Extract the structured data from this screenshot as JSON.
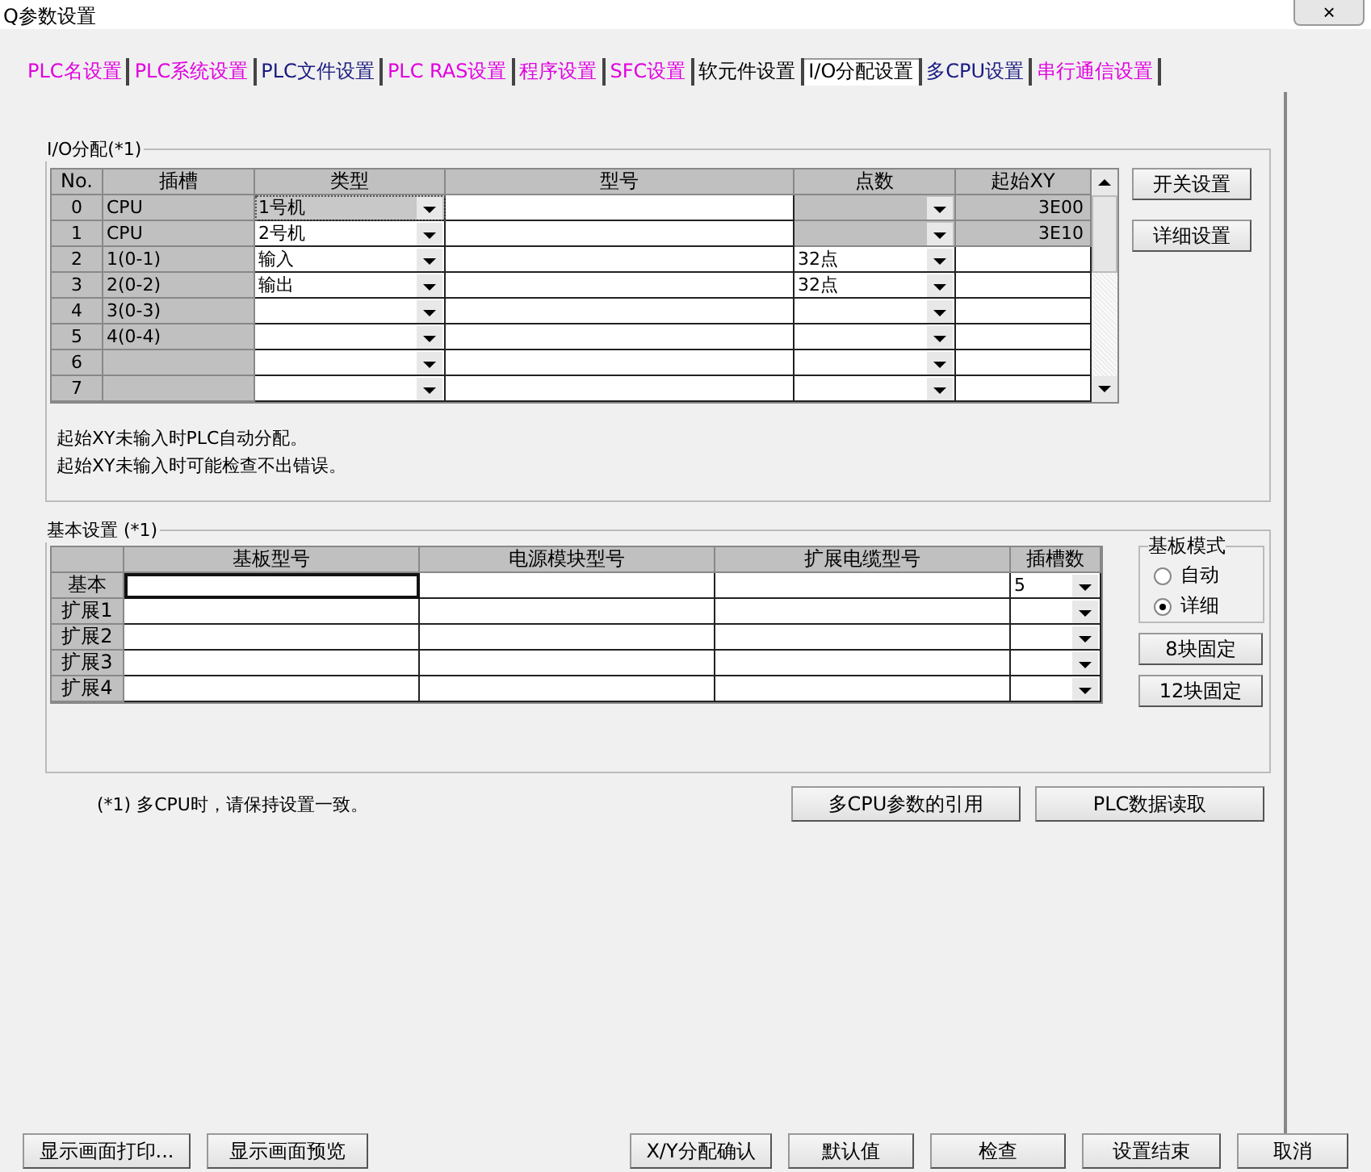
{
  "window": {
    "title": "Q参数设置",
    "close_label": "×"
  },
  "tabs": [
    {
      "label": "PLC名设置",
      "selected": false,
      "color": "#e000e0"
    },
    {
      "label": "PLC系统设置",
      "selected": false,
      "color": "#e000e0"
    },
    {
      "label": "PLC文件设置",
      "selected": false,
      "color": "#1a1a80"
    },
    {
      "label": "PLC RAS设置",
      "selected": false,
      "color": "#e000e0"
    },
    {
      "label": "程序设置",
      "selected": false,
      "color": "#e000e0"
    },
    {
      "label": "SFC设置",
      "selected": false,
      "color": "#e000e0"
    },
    {
      "label": "软元件设置",
      "selected": false,
      "color": "#000000"
    },
    {
      "label": "I/O分配设置",
      "selected": true,
      "color": "#000000"
    },
    {
      "label": "多CPU设置",
      "selected": false,
      "color": "#1a1a80"
    },
    {
      "label": "串行通信设置",
      "selected": false,
      "color": "#e000e0"
    }
  ],
  "io_assignment": {
    "title": "I/O分配(*1)",
    "columns": [
      "No.",
      "插槽",
      "类型",
      "型号",
      "点数",
      "起始XY"
    ],
    "rows": [
      {
        "no": "0",
        "slot": "CPU",
        "type": "1号机",
        "start_xy": "3E00",
        "locked": true,
        "selected": true
      },
      {
        "no": "1",
        "slot": "CPU",
        "type": "2号机",
        "start_xy": "3E10",
        "locked": true,
        "selected": false
      },
      {
        "no": "2",
        "slot": "1(0-1)",
        "type": "输入",
        "points": "32点",
        "locked": false,
        "selected": false
      },
      {
        "no": "3",
        "slot": "2(0-2)",
        "type": "输出",
        "points": "32点",
        "locked": false,
        "selected": false
      },
      {
        "no": "4",
        "slot": "3(0-3)",
        "locked": false,
        "selected": false
      },
      {
        "no": "5",
        "slot": "4(0-4)",
        "locked": false,
        "selected": false
      },
      {
        "no": "6",
        "locked": false,
        "selected": false
      },
      {
        "no": "7",
        "locked": false,
        "selected": false
      }
    ],
    "buttons": [
      "开关设置",
      "详细设置"
    ],
    "notes": [
      "起始XY未输入时PLC自动分配。",
      "起始XY未输入时可能检查不出错误。"
    ]
  },
  "base_settings": {
    "title": "基本设置 (*1)",
    "columns": [
      "基板型号",
      "电源模块型号",
      "扩展电缆型号",
      "插槽数"
    ],
    "rows": [
      {
        "label": "基本",
        "slots": "5"
      },
      {
        "label": "扩展1"
      },
      {
        "label": "扩展2"
      },
      {
        "label": "扩展3"
      },
      {
        "label": "扩展4"
      }
    ],
    "base_mode": {
      "title": "基板模式",
      "options": [
        {
          "label": "自动",
          "selected": false
        },
        {
          "label": "详细",
          "selected": true
        }
      ]
    },
    "buttons": [
      "8块固定",
      "12块固定"
    ]
  },
  "footnote": "(*1) 多CPU时，请保持设置一致。",
  "buttons": [
    "多CPU参数的引用",
    "PLC数据读取"
  ],
  "bottom_buttons": [
    "显示画面打印...",
    "显示画面预览",
    "X/Y分配确认",
    "默认值",
    "检查",
    "设置结束",
    "取消"
  ]
}
